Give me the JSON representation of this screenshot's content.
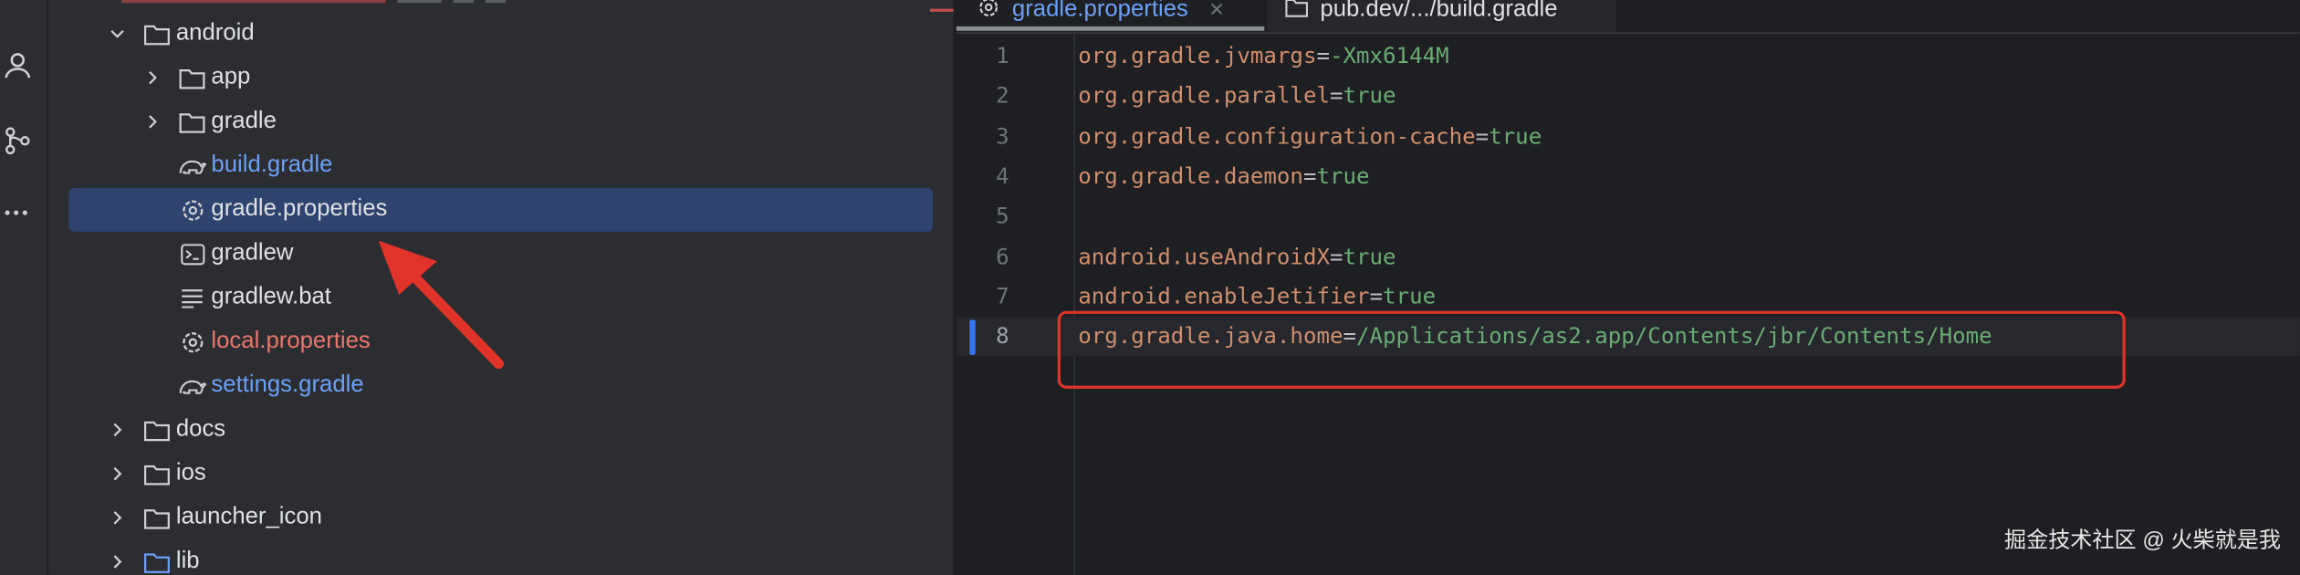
{
  "editor_tabs": [
    {
      "label": "gradle.properties",
      "icon": "gear-icon",
      "active": true
    },
    {
      "label": "pub.dev/.../build.gradle",
      "icon": "folder-icon",
      "active": false
    }
  ],
  "tree": [
    {
      "label": "android",
      "icon": "folder-icon",
      "expander": "chevron-down-icon",
      "color": "white"
    },
    {
      "label": "app",
      "icon": "folder-icon",
      "expander": "chevron-right-icon",
      "color": "white"
    },
    {
      "label": "gradle",
      "icon": "folder-icon",
      "expander": "chevron-right-icon",
      "color": "white"
    },
    {
      "label": "build.gradle",
      "icon": "gradle-elephant-icon",
      "expander": "",
      "color": "blue"
    },
    {
      "label": "gradle.properties",
      "icon": "gear-icon",
      "expander": "",
      "color": "white",
      "selected": true
    },
    {
      "label": "gradlew",
      "icon": "terminal-icon",
      "expander": "",
      "color": "white"
    },
    {
      "label": "gradlew.bat",
      "icon": "text-lines-icon",
      "expander": "",
      "color": "white"
    },
    {
      "label": "local.properties",
      "icon": "gear-icon",
      "expander": "",
      "color": "orange"
    },
    {
      "label": "settings.gradle",
      "icon": "gradle-elephant-icon",
      "expander": "",
      "color": "blue"
    },
    {
      "label": "docs",
      "icon": "folder-icon",
      "expander": "chevron-right-icon",
      "color": "white"
    },
    {
      "label": "ios",
      "icon": "folder-icon",
      "expander": "chevron-right-icon",
      "color": "white"
    },
    {
      "label": "launcher_icon",
      "icon": "folder-icon",
      "expander": "chevron-right-icon",
      "color": "white"
    },
    {
      "label": "lib",
      "icon": "folder-icon",
      "expander": "chevron-right-icon",
      "color": "white"
    }
  ],
  "code_lines": [
    {
      "no": "1",
      "key": "org.gradle.jvmargs",
      "eq": "=",
      "value": "-Xmx6144M"
    },
    {
      "no": "2",
      "key": "org.gradle.parallel",
      "eq": "=",
      "value": "true"
    },
    {
      "no": "3",
      "key": "org.gradle.configuration-cache",
      "eq": "=",
      "value": "true"
    },
    {
      "no": "4",
      "key": "org.gradle.daemon",
      "eq": "=",
      "value": "true"
    },
    {
      "no": "5",
      "key": "",
      "eq": "",
      "value": ""
    },
    {
      "no": "6",
      "key": "android.useAndroidX",
      "eq": "=",
      "value": "true"
    },
    {
      "no": "7",
      "key": "android.enableJetifier",
      "eq": "=",
      "value": "true"
    },
    {
      "no": "8",
      "key": "org.gradle.java.home",
      "eq": "=",
      "value": "/Applications/as2.app/Contents/jbr/Contents/Home",
      "current": true
    }
  ],
  "toolstrip_icons": [
    "person-icon",
    "git-branch-icon",
    "more-icon"
  ],
  "watermark": "掘金技术社区 @ 火柴就是我",
  "colors": {
    "background": "#1e1f22",
    "panel": "#2b2d30",
    "selection": "#2e436e",
    "blue_file": "#6ca0f6",
    "orange_file": "#e9776d",
    "property_key": "#cf8e6d",
    "property_value": "#6aab73",
    "annotation_red": "#e0332a"
  }
}
